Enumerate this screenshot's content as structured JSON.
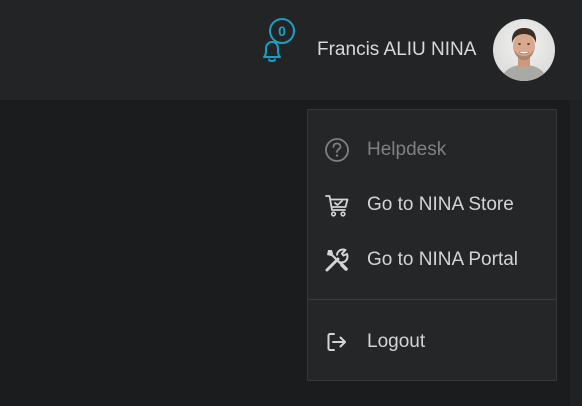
{
  "header": {
    "notifications": {
      "icon": "bell-icon",
      "count": "0",
      "accent_color": "#1aa0c4"
    },
    "user": {
      "name": "Francis ALIU NINA",
      "avatar_icon": "user-avatar-photo"
    }
  },
  "user_menu": {
    "items": [
      {
        "label": "Helpdesk",
        "icon": "help-circle-icon",
        "disabled": true
      },
      {
        "label": "Go to NINA Store",
        "icon": "shopping-cart-check-icon",
        "disabled": false
      },
      {
        "label": "Go to NINA Portal",
        "icon": "tools-icon",
        "disabled": false
      }
    ],
    "logout": {
      "label": "Logout",
      "icon": "logout-icon"
    }
  }
}
